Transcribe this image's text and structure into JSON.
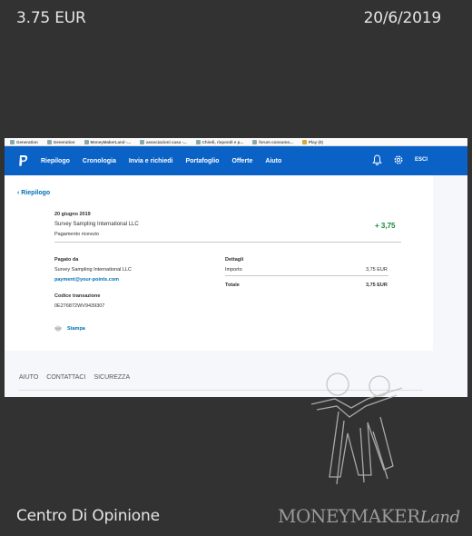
{
  "caption": {
    "amount": "3.75 EUR",
    "date": "20/6/2019",
    "store": "Centro Di Opinione"
  },
  "logo": {
    "text_main": "MONEYMAKER",
    "text_script": "Land"
  },
  "bookmarks": [
    "Generation",
    "Generation",
    "MoneyMakerLand -...",
    "associazioni casa -...",
    "Chiedi, rispondi e p...",
    "forum consumo...",
    "Play (0)"
  ],
  "paypal_nav": {
    "items": [
      "Riepilogo",
      "Cronologia",
      "Invia e richiedi",
      "Portafoglio",
      "Offerte",
      "Aiuto"
    ],
    "logout": "ESCI",
    "brand_color": "#0a62c7"
  },
  "transaction": {
    "back_label": "Riepilogo",
    "date": "20 giugno 2019",
    "merchant": "Survey Sampling International LLC",
    "status": "Pagamento ricevuto",
    "amount": "+ 3,75",
    "paid_by_label": "Pagato da",
    "paid_by_name": "Survey Sampling International LLC",
    "paid_by_email": "payment@your-points.com",
    "code_label": "Codice transazione",
    "code": "0E276872WV9439307",
    "print_label": "Stampa",
    "details_label": "Dettagli",
    "import_label": "Importo",
    "import_value": "3,75 EUR",
    "total_label": "Totale",
    "total_value": "3,75 EUR"
  },
  "footer": [
    "AIUTO",
    "CONTATTACI",
    "SICUREZZA"
  ]
}
